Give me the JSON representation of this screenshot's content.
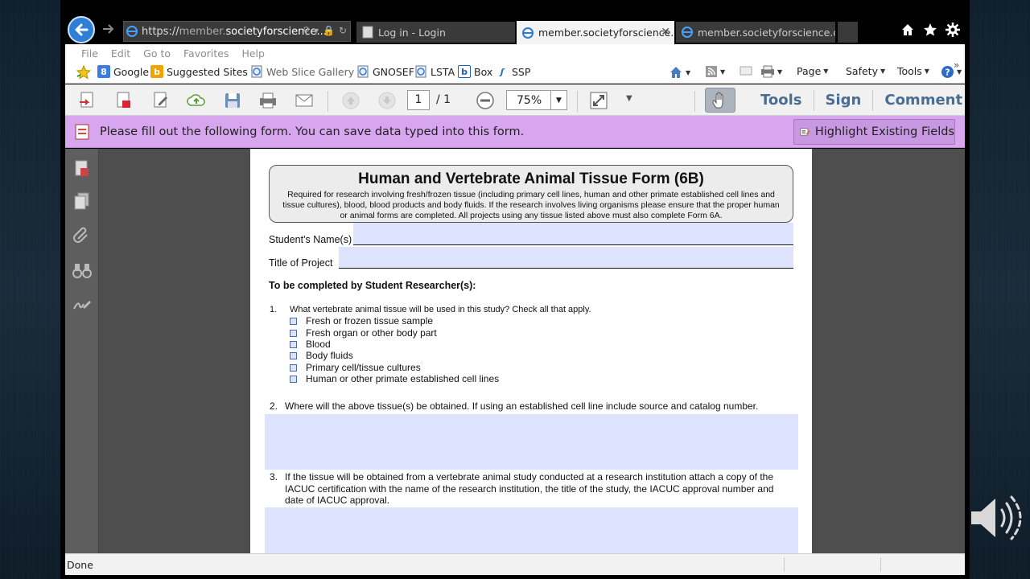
{
  "browser": {
    "url": {
      "protocol": "https://",
      "subdomain": "member.",
      "domain": "societyforscience...",
      "suffix": ""
    },
    "tabs": [
      {
        "label": "Log in - Login",
        "active": false
      },
      {
        "label": "member.societyforscience....",
        "active": true
      },
      {
        "label": "member.societyforscience.org",
        "active": false
      }
    ],
    "menu": [
      "File",
      "Edit",
      "Go to",
      "Favorites",
      "Help"
    ],
    "favorites": [
      "Google",
      "Suggested Sites",
      "Web Slice Gallery",
      "GNOSEF",
      "LSTA",
      "Box",
      "SSP"
    ],
    "commands": [
      "Page",
      "Safety",
      "Tools"
    ],
    "status": "Done"
  },
  "pdf_toolbar": {
    "page_current": "1",
    "page_total": "/ 1",
    "zoom": "75%",
    "links": [
      "Tools",
      "Sign",
      "Comment"
    ]
  },
  "message_bar": {
    "text": "Please fill out the following form. You can save data typed into this form.",
    "button": "Highlight Existing Fields"
  },
  "form": {
    "title": "Human and Vertebrate Animal Tissue Form (6B)",
    "subtitle_lines": [
      "Required for research involving fresh/frozen tissue (including primary cell lines, human and other primate established cell lines and",
      "tissue cultures), blood, blood products and body fluids. If the research involves living organisms please ensure that the proper human",
      "or animal forms are completed. All projects using any tissue listed above must also complete Form 6A."
    ],
    "student_label": "Student's Name(s)",
    "title_label": "Title of Project",
    "section": "To be completed by Student Researcher(s):",
    "q1": {
      "num": "1.",
      "text": "What vertebrate animal tissue will be used in this study?  Check all that apply."
    },
    "q1_options": [
      "Fresh or frozen tissue sample",
      "Fresh organ or other body part",
      "Blood",
      "Body fluids",
      "Primary cell/tissue cultures",
      "Human or other primate established cell lines"
    ],
    "q2": {
      "num": "2.",
      "text": "Where will the above tissue(s) be obtained.  If using an established cell line include source and catalog number."
    },
    "q3": {
      "num": "3.",
      "lines": [
        "If the tissue will be obtained from a vertebrate animal study conducted at a research institution attach a copy of the",
        "IACUC certification with the name of the research institution, the title of the study, the IACUC approval number and",
        "date of IACUC approval."
      ]
    }
  }
}
